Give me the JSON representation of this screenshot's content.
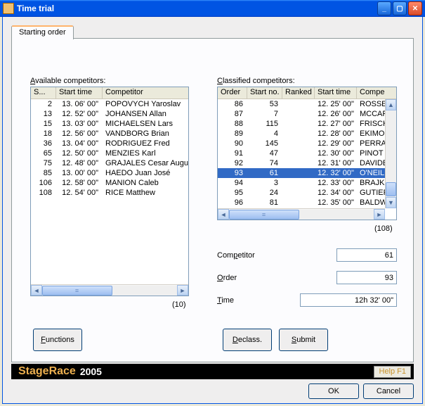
{
  "window": {
    "title": "Time trial",
    "minimize_tip": "Minimize",
    "maximize_tip": "Maximize",
    "close_tip": "Close"
  },
  "tab": {
    "label": "Starting order"
  },
  "left": {
    "label": "Available competitors:",
    "label_underline": "A",
    "columns": {
      "c0": "S...",
      "c1": "Start time",
      "c2": "Competitor"
    },
    "rows": [
      {
        "s": "2",
        "t": "13. 06' 00\"",
        "n": "POPOVYCH Yaroslav"
      },
      {
        "s": "13",
        "t": "12. 52' 00\"",
        "n": "JOHANSEN Allan"
      },
      {
        "s": "15",
        "t": "13. 03' 00\"",
        "n": "MICHAELSEN Lars"
      },
      {
        "s": "18",
        "t": "12. 56' 00\"",
        "n": "VANDBORG Brian"
      },
      {
        "s": "36",
        "t": "13. 04' 00\"",
        "n": "RODRIGUEZ Fred"
      },
      {
        "s": "65",
        "t": "12. 50' 00\"",
        "n": "MENZIES Karl"
      },
      {
        "s": "75",
        "t": "12. 48' 00\"",
        "n": "GRAJALES Cesar Augu"
      },
      {
        "s": "85",
        "t": "13. 00' 00\"",
        "n": "HAEDO Juan José"
      },
      {
        "s": "106",
        "t": "12. 58' 00\"",
        "n": "MANION Caleb"
      },
      {
        "s": "108",
        "t": "12. 54' 00\"",
        "n": "RICE Matthew"
      }
    ],
    "count": "(10)"
  },
  "right": {
    "label": "Classified competitors:",
    "label_underline": "C",
    "columns": {
      "c0": "Order",
      "c1": "Start no.",
      "c2": "Ranked",
      "c3": "Start time",
      "c4": "Compe"
    },
    "rows": [
      {
        "o": "86",
        "s": "53",
        "r": "",
        "t": "12. 25' 00\"",
        "n": "ROSSE"
      },
      {
        "o": "87",
        "s": "7",
        "r": "",
        "t": "12. 26' 00\"",
        "n": "MCCAR"
      },
      {
        "o": "88",
        "s": "115",
        "r": "",
        "t": "12. 27' 00\"",
        "n": "FRISCH"
      },
      {
        "o": "89",
        "s": "4",
        "r": "",
        "t": "12. 28' 00\"",
        "n": "EKIMO"
      },
      {
        "o": "90",
        "s": "145",
        "r": "",
        "t": "12. 29' 00\"",
        "n": "PERRA"
      },
      {
        "o": "91",
        "s": "47",
        "r": "",
        "t": "12. 30' 00\"",
        "n": "PINOT"
      },
      {
        "o": "92",
        "s": "74",
        "r": "",
        "t": "12. 31' 00\"",
        "n": "DAVIDE"
      },
      {
        "o": "93",
        "s": "61",
        "r": "",
        "t": "12. 32' 00\"",
        "n": "O'NEILL",
        "selected": true
      },
      {
        "o": "94",
        "s": "3",
        "r": "",
        "t": "12. 33' 00\"",
        "n": "BRAJK"
      },
      {
        "o": "95",
        "s": "24",
        "r": "",
        "t": "12. 34' 00\"",
        "n": "GUTIEF"
      },
      {
        "o": "96",
        "s": "81",
        "r": "",
        "t": "12. 35' 00\"",
        "n": "BALDW"
      }
    ],
    "count": "(108)"
  },
  "form": {
    "competitor_label": "Competitor",
    "competitor_underline": "p",
    "competitor_value": "61",
    "order_label": "Order",
    "order_underline": "O",
    "order_value": "93",
    "time_label": "Time",
    "time_underline": "T",
    "time_value": "12h 32' 00\""
  },
  "buttons": {
    "functions": "Functions",
    "functions_underline": "F",
    "declass": "Declass.",
    "declass_underline": "D",
    "submit": "Submit",
    "submit_underline": "S",
    "ok": "OK",
    "cancel": "Cancel",
    "help": "Help F1"
  },
  "footer": {
    "app": "StageRace",
    "year": "2005"
  }
}
